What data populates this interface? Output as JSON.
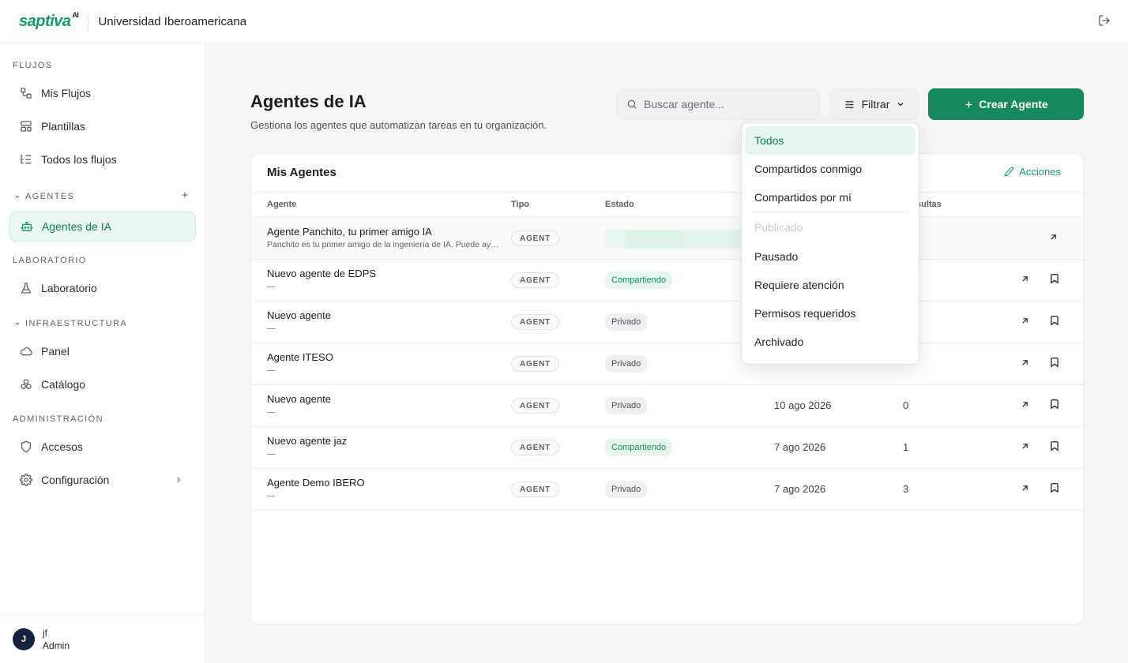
{
  "header": {
    "logo_text": "saptiva",
    "logo_sup": "AI",
    "org_name": "Universidad Iberoamericana",
    "logout_icon": "logout-icon"
  },
  "sidebar": {
    "sections": {
      "flujos": "FLUJOS",
      "agentes": "AGENTES",
      "laboratorio": "LABORATORIO",
      "infraestructura": "INFRAESTRUCTURA",
      "administracion": "ADMINISTRACIÓN"
    },
    "items": [
      {
        "label": "Mis Flujos",
        "icon": "flow-icon"
      },
      {
        "label": "Plantillas",
        "icon": "template-icon"
      },
      {
        "label": "Todos los flujos",
        "icon": "list-tree-icon"
      },
      {
        "label": "Agentes de IA",
        "icon": "robot-icon"
      },
      {
        "label": "Laboratorio",
        "icon": "flask-icon"
      },
      {
        "label": "Panel",
        "icon": "cloud-icon"
      },
      {
        "label": "Catálogo",
        "icon": "boxes-icon"
      },
      {
        "label": "Accesos",
        "icon": "shield-icon"
      },
      {
        "label": "Configuración",
        "icon": "gear-icon"
      }
    ],
    "user": {
      "initial": "J",
      "name": "jf",
      "role": "Admin"
    }
  },
  "main": {
    "title": "Agentes de IA",
    "subtitle": "Gestiona los agentes que automatizan tareas en tu organización.",
    "search_placeholder": "Buscar agente...",
    "filter_label": "Filtrar",
    "create_label": "Crear Agente",
    "accent": "#168a5d"
  },
  "card": {
    "title": "Mis Agentes",
    "actions_label": "Acciones",
    "columns": {
      "agent": "Agente",
      "type": "Tipo",
      "state": "Estado",
      "queries": "sultas"
    },
    "rows": [
      {
        "name": "Agente Panchito, tu primer amigo IA",
        "desc": "Panchito es tu primer amigo de la ingeniería de IA. Puede ayudarte con tus dudas",
        "type": "AGENT",
        "state": "",
        "date": "",
        "count": ""
      },
      {
        "name": "Nuevo agente de EDPS",
        "desc": "—",
        "type": "AGENT",
        "state": "Compartiendo",
        "date": "",
        "count": ""
      },
      {
        "name": "Nuevo agente",
        "desc": "—",
        "type": "AGENT",
        "state": "Privado",
        "date": "",
        "count": ""
      },
      {
        "name": "Agente ITESO",
        "desc": "—",
        "type": "AGENT",
        "state": "Privado",
        "date": "",
        "count": ""
      },
      {
        "name": "Nuevo agente",
        "desc": "—",
        "type": "AGENT",
        "state": "Privado",
        "date": "10 ago 2026",
        "count": "0"
      },
      {
        "name": "Nuevo agente jaz",
        "desc": "—",
        "type": "AGENT",
        "state": "Compartiendo",
        "date": "7 ago 2026",
        "count": "1"
      },
      {
        "name": "Agente Demo IBERO",
        "desc": "—",
        "type": "AGENT",
        "state": "Privado",
        "date": "7 ago 2026",
        "count": "3"
      }
    ]
  },
  "filter_menu": {
    "items": [
      "Todos",
      "Compartidos conmigo",
      "Compartidos por mí",
      "Publicado",
      "Pausado",
      "Requiere atención",
      "Permisos requeridos",
      "Archivado"
    ],
    "selected": "Todos"
  }
}
